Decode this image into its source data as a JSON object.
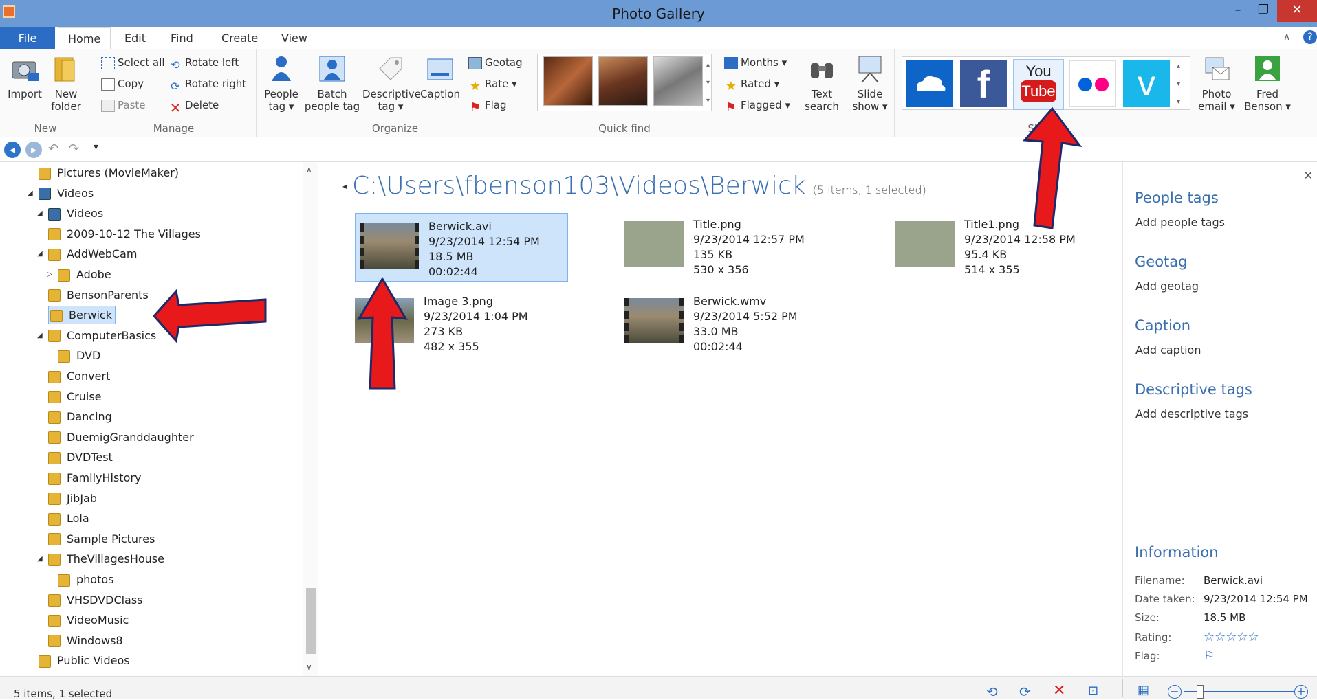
{
  "window": {
    "title": "Photo Gallery"
  },
  "tabs": [
    "File",
    "Home",
    "Edit",
    "Find",
    "Create",
    "View"
  ],
  "ribbon": {
    "new": {
      "label": "New",
      "import": "Import",
      "new_folder_1": "New",
      "new_folder_2": "folder"
    },
    "manage": {
      "label": "Manage",
      "select_all": "Select all",
      "copy": "Copy",
      "paste": "Paste",
      "rotate_left": "Rotate left",
      "rotate_right": "Rotate right",
      "delete": "Delete"
    },
    "organize": {
      "label": "Organize",
      "people_tag_1": "People",
      "people_tag_2": "tag",
      "batch_1": "Batch",
      "batch_2": "people tag",
      "descriptive_1": "Descriptive",
      "descriptive_2": "tag",
      "caption": "Caption",
      "geotag": "Geotag",
      "rate": "Rate",
      "flag": "Flag"
    },
    "quickfind": {
      "label": "Quick find",
      "months": "Months",
      "rated": "Rated",
      "flagged": "Flagged",
      "text_search_1": "Text",
      "text_search_2": "search"
    },
    "slideshow": {
      "l1": "Slide",
      "l2": "show"
    },
    "share": {
      "label": "Share",
      "photo_email_1": "Photo",
      "photo_email_2": "email",
      "user_1": "Fred",
      "user_2": "Benson",
      "youtube_1": "You",
      "youtube_2": "Tube"
    }
  },
  "tree": [
    {
      "label": "Pictures (MovieMaker)",
      "level": 1
    },
    {
      "label": "Videos",
      "level": 1,
      "expanded": true,
      "type": "library"
    },
    {
      "label": "Videos",
      "level": 2,
      "expanded": true,
      "type": "library"
    },
    {
      "label": "2009-10-12 The Villages",
      "level": 3
    },
    {
      "label": "AddWebCam",
      "level": 3,
      "expanded": true
    },
    {
      "label": "Adobe",
      "level": 4,
      "collapsed": true
    },
    {
      "label": "BensonParents",
      "level": 3
    },
    {
      "label": "Berwick",
      "level": 3,
      "selected": true
    },
    {
      "label": "ComputerBasics",
      "level": 3,
      "expanded": true
    },
    {
      "label": "DVD",
      "level": 4
    },
    {
      "label": "Convert",
      "level": 3
    },
    {
      "label": "Cruise",
      "level": 3
    },
    {
      "label": "Dancing",
      "level": 3
    },
    {
      "label": "DuemigGranddaughter",
      "level": 3
    },
    {
      "label": "DVDTest",
      "level": 3
    },
    {
      "label": "FamilyHistory",
      "level": 3
    },
    {
      "label": "JibJab",
      "level": 3
    },
    {
      "label": "Lola",
      "level": 3
    },
    {
      "label": "Sample Pictures",
      "level": 3
    },
    {
      "label": "TheVillagesHouse",
      "level": 3,
      "expanded": true
    },
    {
      "label": "photos",
      "level": 4
    },
    {
      "label": "VHSDVDClass",
      "level": 3
    },
    {
      "label": "VideoMusic",
      "level": 3
    },
    {
      "label": "Windows8",
      "level": 3
    },
    {
      "label": "Public Videos",
      "level": 1
    }
  ],
  "content": {
    "path": "C:\\Users\\fbenson103\\Videos\\Berwick",
    "info": "(5 items, 1 selected)",
    "items": [
      {
        "name": "Berwick.avi",
        "date": "9/23/2014 12:54 PM",
        "size": "18.5 MB",
        "extra": "00:02:44",
        "type": "video",
        "selected": true
      },
      {
        "name": "Title.png",
        "date": "9/23/2014 12:57 PM",
        "size": "135 KB",
        "extra": "530 x 356",
        "type": "title"
      },
      {
        "name": "Title1.png",
        "date": "9/23/2014 12:58 PM",
        "size": "95.4 KB",
        "extra": "514 x 355",
        "type": "title"
      },
      {
        "name": "Image 3.png",
        "date": "9/23/2014 1:04 PM",
        "size": "273 KB",
        "extra": "482 x 355",
        "type": "photo"
      },
      {
        "name": "Berwick.wmv",
        "date": "9/23/2014 5:52 PM",
        "size": "33.0 MB",
        "extra": "00:02:44",
        "type": "video"
      }
    ]
  },
  "pane": {
    "people_h": "People tags",
    "people_a": "Add people tags",
    "geotag_h": "Geotag",
    "geotag_a": "Add geotag",
    "caption_h": "Caption",
    "caption_a": "Add caption",
    "desc_h": "Descriptive tags",
    "desc_a": "Add descriptive tags",
    "info_h": "Information",
    "info": [
      {
        "k": "Filename:",
        "v": "Berwick.avi"
      },
      {
        "k": "Date taken:",
        "v": "9/23/2014  12:54 PM"
      },
      {
        "k": "Size:",
        "v": "18.5 MB"
      },
      {
        "k": "Rating:",
        "v": "☆☆☆☆☆"
      },
      {
        "k": "Flag:",
        "v": "⚐"
      }
    ]
  },
  "status": {
    "text": "5 items, 1 selected"
  },
  "colors": {
    "accent": "#2b6cc4",
    "arrow": "#e8191b",
    "selection": "#cde4fb"
  }
}
